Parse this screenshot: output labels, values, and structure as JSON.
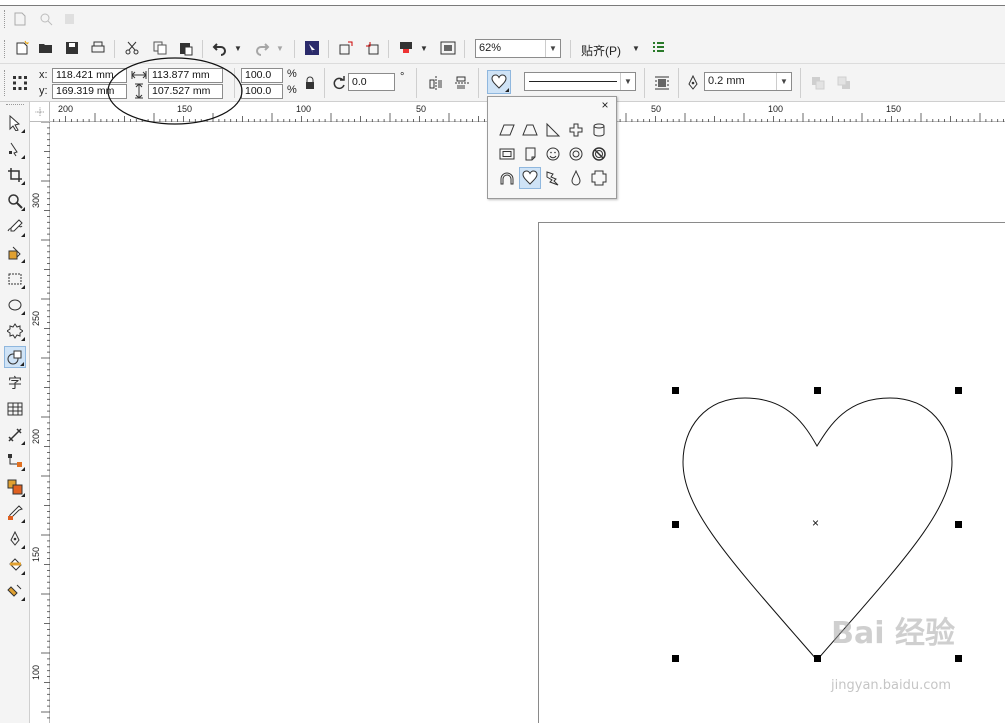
{
  "property_bar": {
    "x_label": "x:",
    "y_label": "y:",
    "x_value": "118.421 mm",
    "y_value": "169.319 mm",
    "width_value": "113.877 mm",
    "height_value": "107.527 mm",
    "scale_x": "100.0",
    "scale_y": "100.0",
    "percent_symbol": "%",
    "rotation": "0.0",
    "degree_symbol": "°",
    "outline_width": "0.2 mm"
  },
  "standard_bar": {
    "zoom_level": "62%",
    "snap_label": "贴齐(P)"
  },
  "rulers": {
    "horizontal_labels": [
      "200",
      "150",
      "100",
      "50",
      "50",
      "100",
      "150"
    ],
    "vertical_labels": [
      "300",
      "250",
      "200",
      "150",
      "100"
    ]
  },
  "flyout": {
    "close_glyph": "×",
    "selected_shape": "heart"
  },
  "watermark": {
    "main": "Bai 经验",
    "sub": "jingyan.baidu.com"
  },
  "colors": {
    "selection_highlight": "#cfe3f6",
    "annotation_ellipse": "#000000"
  }
}
